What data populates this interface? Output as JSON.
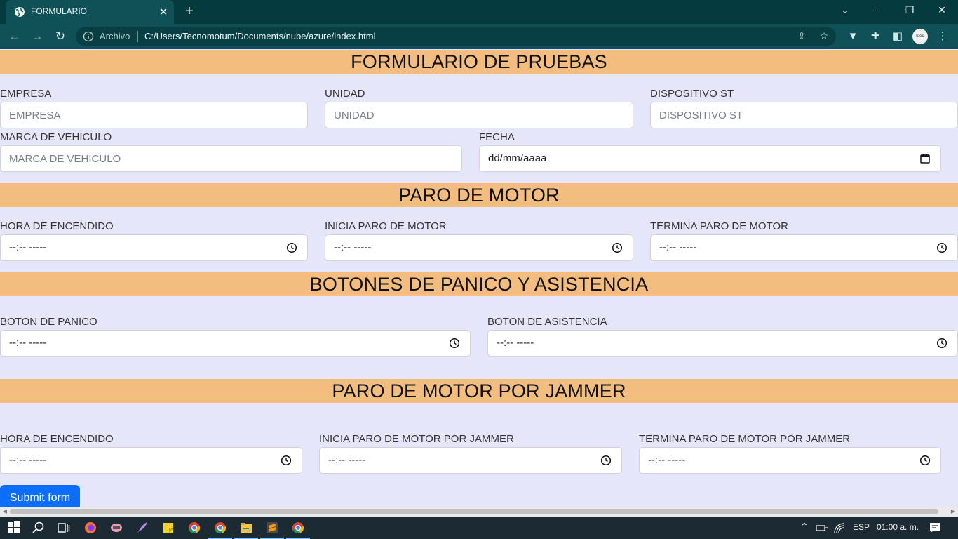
{
  "browser": {
    "tab_title": "FORMULARIO",
    "scheme_label": "Archivo",
    "url": "C:/Users/Tecnomotum/Documents/nube/azure/index.html",
    "profile_text": "Ideo"
  },
  "form": {
    "title": "FORMULARIO DE PRUEBAS",
    "empresa": {
      "label": "EMPRESA",
      "placeholder": "EMPRESA"
    },
    "unidad": {
      "label": "UNIDAD",
      "placeholder": "UNIDAD"
    },
    "dispositivo": {
      "label": "DISPOSITIVO ST",
      "placeholder": "DISPOSITIVO ST"
    },
    "marca": {
      "label": "MARCA DE VEHICULO",
      "placeholder": "MARCA DE VEHICULO"
    },
    "fecha": {
      "label": "FECHA",
      "value": "dd/mm/aaaa"
    }
  },
  "paro_motor": {
    "title": "PARO DE MOTOR",
    "hora_encendido": {
      "label": "HORA DE ENCENDIDO",
      "value": "--:-- -----"
    },
    "inicia": {
      "label": "INICIA PARO DE MOTOR",
      "value": "--:-- -----"
    },
    "termina": {
      "label": "TERMINA PARO DE MOTOR",
      "value": "--:-- -----"
    }
  },
  "botones": {
    "title": "BOTONES DE PANICO Y ASISTENCIA",
    "panico": {
      "label": "BOTON DE PANICO",
      "value": "--:-- -----"
    },
    "asistencia": {
      "label": "BOTON DE ASISTENCIA",
      "value": "--:-- -----"
    }
  },
  "jammer": {
    "title": "PARO DE MOTOR POR JAMMER",
    "hora_encendido": {
      "label": "HORA DE ENCENDIDO",
      "value": "--:-- -----"
    },
    "inicia": {
      "label": "INICIA PARO DE MOTOR POR JAMMER",
      "value": "--:-- -----"
    },
    "termina": {
      "label": "TERMINA PARO DE MOTOR POR JAMMER",
      "value": "--:-- -----"
    }
  },
  "submit_label": "Submit form",
  "taskbar": {
    "language": "ESP",
    "time": "01:00 a. m."
  },
  "colors": {
    "banner": "#f2bd7e",
    "page_bg": "#e6e6fa",
    "submit": "#0d6efd",
    "chrome": "#0f5157"
  }
}
